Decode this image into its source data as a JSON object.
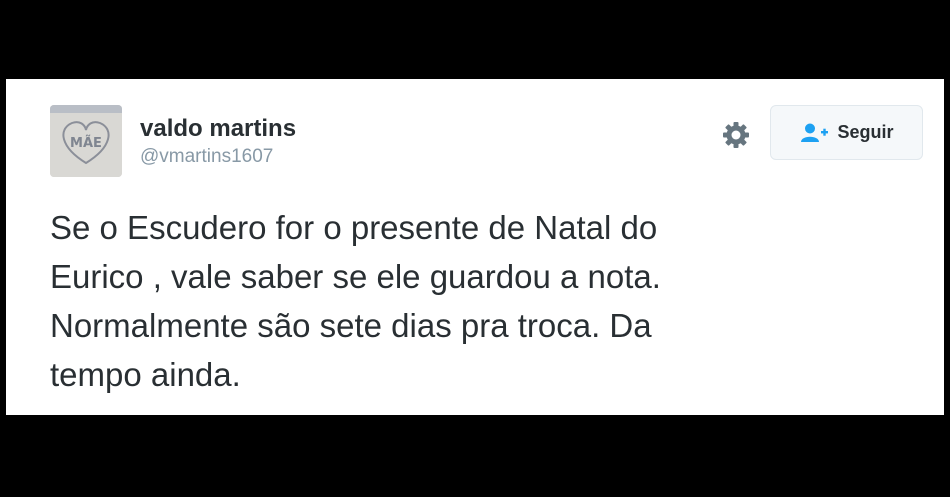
{
  "tweet": {
    "author": {
      "display_name": "valdo martins",
      "handle": "@vmartins1607",
      "avatar_text": "MÃE"
    },
    "actions": {
      "settings_icon": "gear-icon",
      "follow_icon": "person-add-icon",
      "follow_label": "Seguir"
    },
    "text": "Se o Escudero for o presente de Natal do\nEurico , vale saber se ele guardou a nota.\nNormalmente são sete dias pra troca. Da\ntempo ainda."
  },
  "colors": {
    "background": "#000000",
    "card": "#ffffff",
    "text": "#292f33",
    "muted": "#8899a6",
    "accent": "#1da1f2"
  }
}
